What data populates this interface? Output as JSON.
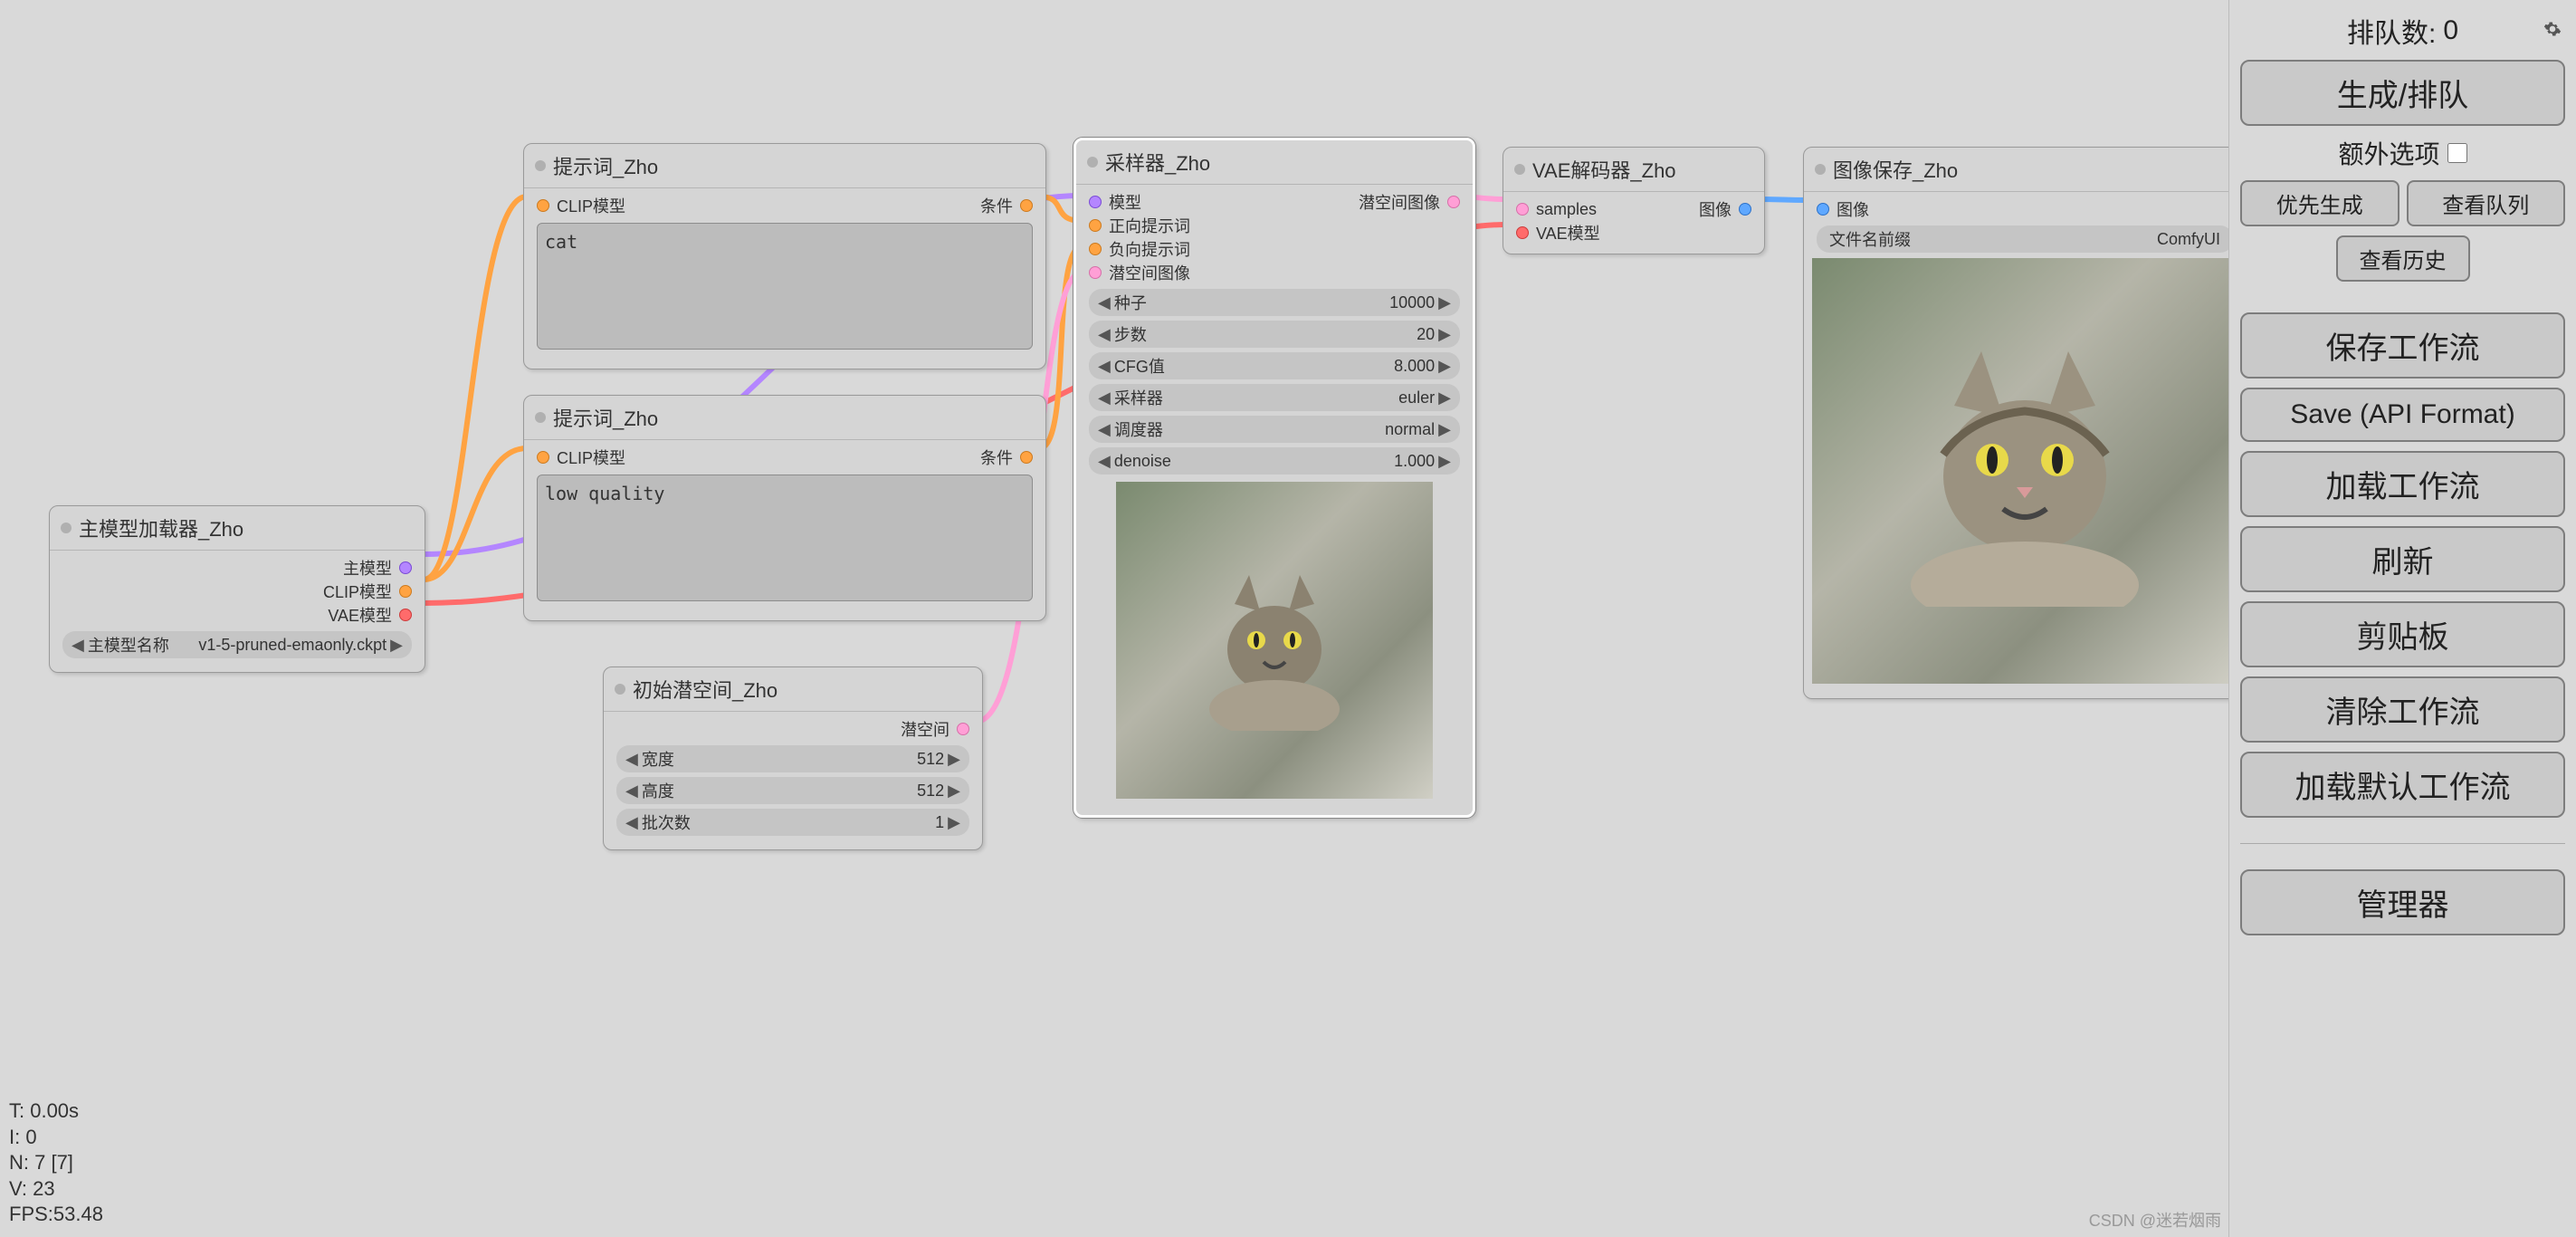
{
  "queue": {
    "label": "排队数:",
    "count": "0"
  },
  "sidebar": {
    "generate": "生成/排队",
    "extra_options": "额外选项",
    "priority": "优先生成",
    "view_queue": "查看队列",
    "view_history": "查看历史",
    "save_workflow": "保存工作流",
    "save_api": "Save (API Format)",
    "load_workflow": "加载工作流",
    "refresh": "刷新",
    "clipboard": "剪贴板",
    "clear_workflow": "清除工作流",
    "load_default": "加载默认工作流",
    "manager": "管理器"
  },
  "nodes": {
    "loader": {
      "title": "主模型加载器_Zho",
      "outputs": {
        "model": "主模型",
        "clip": "CLIP模型",
        "vae": "VAE模型"
      },
      "widget": {
        "label": "主模型名称",
        "value": "v1-5-pruned-emaonly.ckpt"
      }
    },
    "prompt_pos": {
      "title": "提示词_Zho",
      "input": "CLIP模型",
      "output": "条件",
      "text": "cat"
    },
    "prompt_neg": {
      "title": "提示词_Zho",
      "input": "CLIP模型",
      "output": "条件",
      "text": "low quality"
    },
    "latent": {
      "title": "初始潜空间_Zho",
      "output": "潜空间",
      "widgets": {
        "width": {
          "label": "宽度",
          "value": "512"
        },
        "height": {
          "label": "高度",
          "value": "512"
        },
        "batch": {
          "label": "批次数",
          "value": "1"
        }
      }
    },
    "sampler": {
      "title": "采样器_Zho",
      "inputs": {
        "model": "模型",
        "positive": "正向提示词",
        "negative": "负向提示词",
        "latent": "潜空间图像"
      },
      "output": "潜空间图像",
      "widgets": {
        "seed": {
          "label": "种子",
          "value": "10000"
        },
        "steps": {
          "label": "步数",
          "value": "20"
        },
        "cfg": {
          "label": "CFG值",
          "value": "8.000"
        },
        "sampler": {
          "label": "采样器",
          "value": "euler"
        },
        "scheduler": {
          "label": "调度器",
          "value": "normal"
        },
        "denoise": {
          "label": "denoise",
          "value": "1.000"
        }
      }
    },
    "vae_decode": {
      "title": "VAE解码器_Zho",
      "inputs": {
        "samples": "samples",
        "vae": "VAE模型"
      },
      "output": "图像"
    },
    "save": {
      "title": "图像保存_Zho",
      "input": "图像",
      "widget": {
        "label": "文件名前缀",
        "value": "ComfyUI"
      }
    }
  },
  "stats": {
    "t": "T: 0.00s",
    "i": "I: 0",
    "n": "N: 7 [7]",
    "v": "V: 23",
    "fps": "FPS:53.48"
  },
  "watermark": "CSDN @迷若烟雨"
}
